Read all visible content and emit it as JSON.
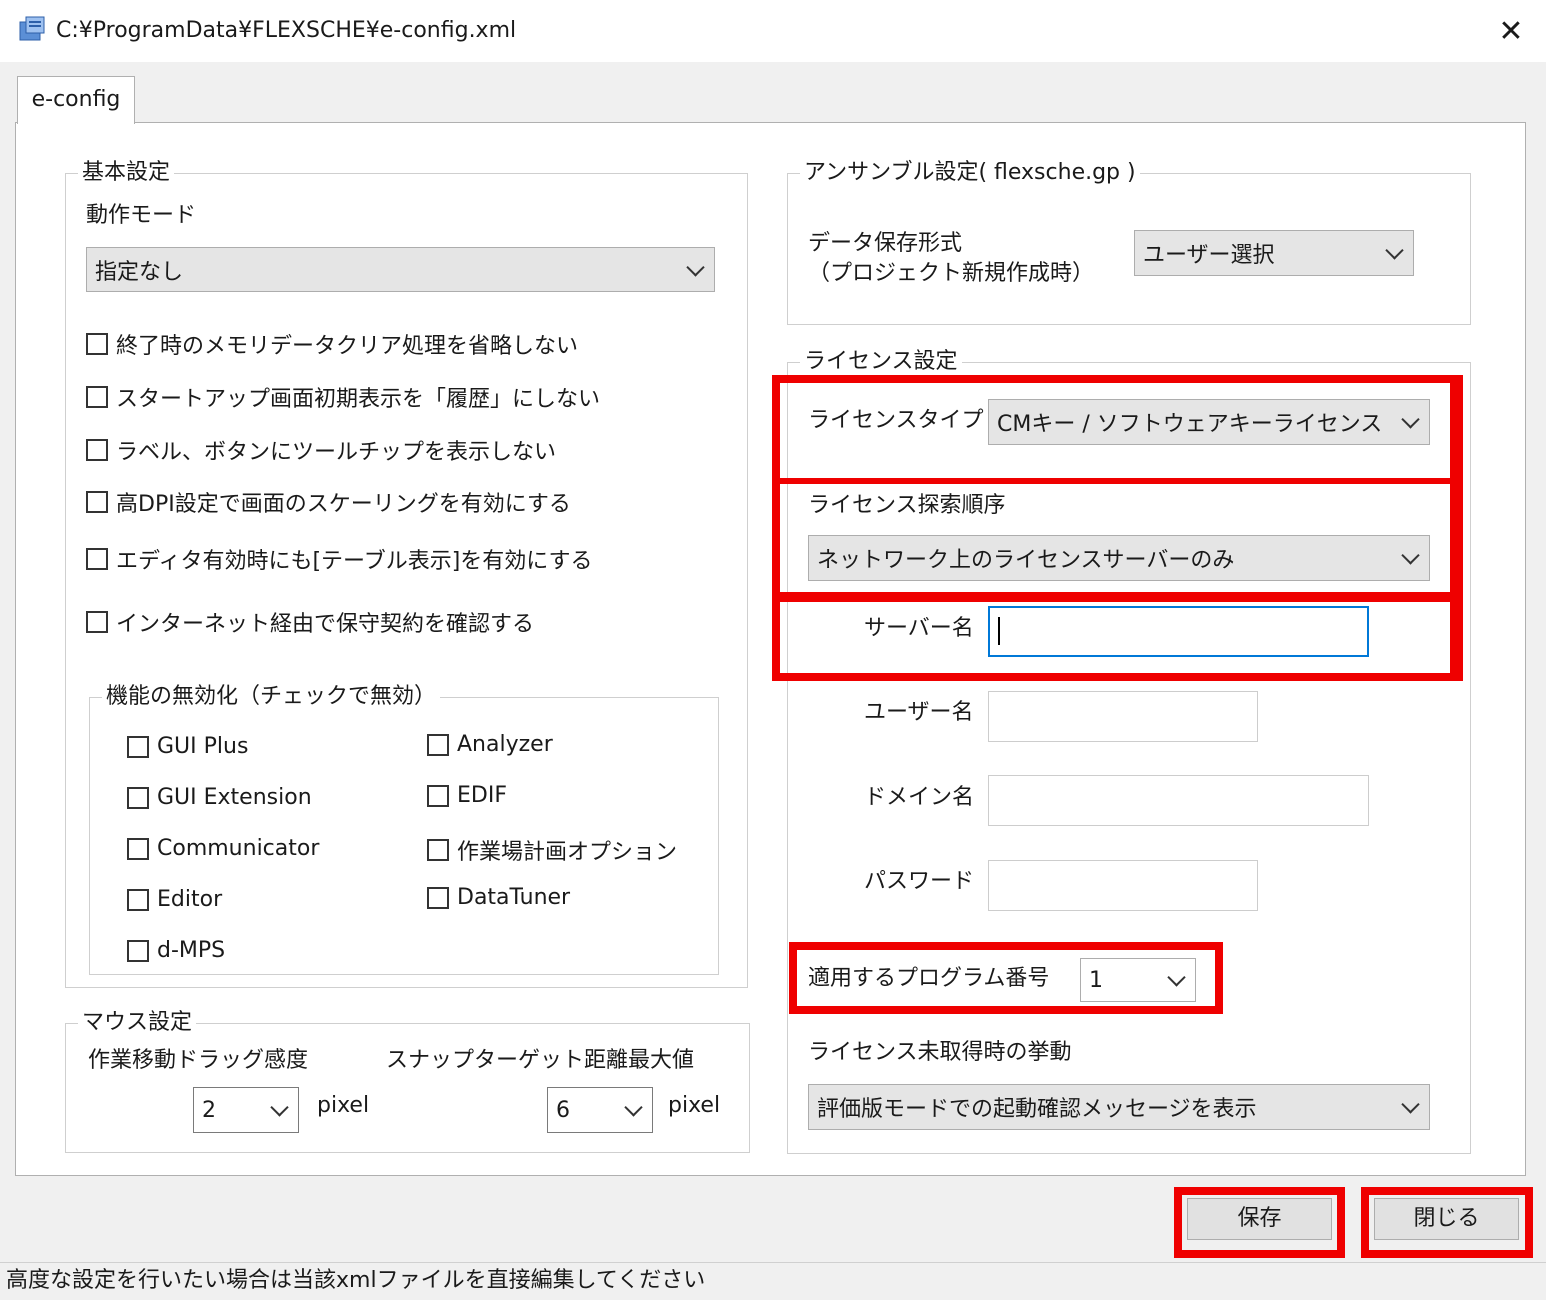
{
  "window": {
    "title": "C:¥ProgramData¥FLEXSCHE¥e-config.xml",
    "close_glyph": "✕",
    "app_icon": "config-app-icon"
  },
  "tabs": [
    {
      "label": "e-config"
    }
  ],
  "basic": {
    "legend": "基本設定",
    "mode_label": "動作モード",
    "mode_value": "指定なし",
    "checkboxes": [
      {
        "label": "終了時のメモリデータクリア処理を省略しない",
        "checked": false
      },
      {
        "label": "スタートアップ画面初期表示を「履歴」にしない",
        "checked": false
      },
      {
        "label": "ラベル、ボタンにツールチップを表示しない",
        "checked": false
      },
      {
        "label": "高DPI設定で画面のスケーリングを有効にする",
        "checked": false
      },
      {
        "label": "エディタ有効時にも[テーブル表示]を有効にする",
        "checked": false
      },
      {
        "label": "インターネット経由で保守契約を確認する",
        "checked": false
      }
    ]
  },
  "disable": {
    "legend": "機能の無効化（チェックで無効）",
    "items": [
      {
        "label": "GUI Plus",
        "checked": false
      },
      {
        "label": "Analyzer",
        "checked": false
      },
      {
        "label": "GUI Extension",
        "checked": false
      },
      {
        "label": "EDIF",
        "checked": false
      },
      {
        "label": "Communicator",
        "checked": false
      },
      {
        "label": "作業場計画オプション",
        "checked": false
      },
      {
        "label": "Editor",
        "checked": false
      },
      {
        "label": "DataTuner",
        "checked": false
      },
      {
        "label": "d-MPS",
        "checked": false
      }
    ]
  },
  "mouse": {
    "legend": "マウス設定",
    "drag_label": "作業移動ドラッグ感度",
    "drag_value": "2",
    "drag_unit": "pixel",
    "snap_label": "スナップターゲット距離最大値",
    "snap_value": "6",
    "snap_unit": "pixel"
  },
  "ensemble": {
    "legend": "アンサンブル設定( flexsche.gp )",
    "format_label_1": "データ保存形式",
    "format_label_2": "（プロジェクト新規作成時）",
    "format_value": "ユーザー選択"
  },
  "license": {
    "legend": "ライセンス設定",
    "type_label": "ライセンスタイプ",
    "type_value": "CMキー / ソフトウェアキーライセンス",
    "search_label": "ライセンス探索順序",
    "search_value": "ネットワーク上のライセンスサーバーのみ",
    "server_label": "サーバー名",
    "server_value": "",
    "user_label": "ユーザー名",
    "user_value": "",
    "domain_label": "ドメイン名",
    "domain_value": "",
    "password_label": "パスワード",
    "password_value": "",
    "program_label": "適用するプログラム番号",
    "program_value": "1",
    "fallback_label": "ライセンス未取得時の挙動",
    "fallback_value": "評価版モードでの起動確認メッセージを表示"
  },
  "buttons": {
    "save": "保存",
    "close": "閉じる"
  },
  "status": {
    "text": "高度な設定を行いたい場合は当該xmlファイルを直接編集してください"
  },
  "colors": {
    "highlight": "#ef0000",
    "focus": "#0078d7"
  }
}
